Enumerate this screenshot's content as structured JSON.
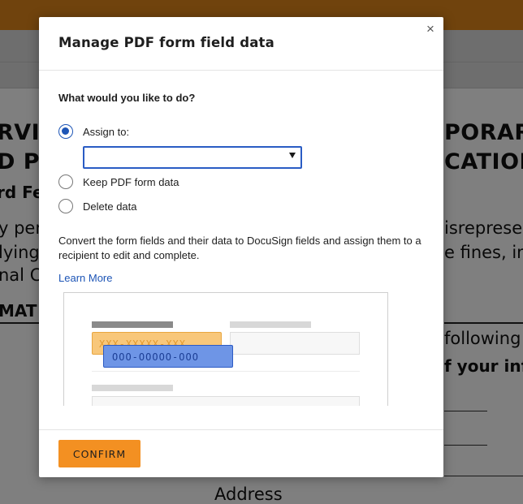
{
  "background": {
    "document_text": {
      "left_line1": "RVIC",
      "left_line2": "D PS",
      "left_line3": "rd Fe",
      "left_line4": "y per",
      "left_line5": "lying",
      "left_line6": "nal Co",
      "left_line7": "MAT",
      "right_line1": "PORAR",
      "right_line2": "CATION",
      "right_line3": "isrepresen",
      "right_line4": "e fines, im",
      "right_line5": "following i",
      "right_line6": "f your info",
      "bottom": "Address"
    }
  },
  "modal": {
    "title": "Manage PDF form field data",
    "close_glyph": "×",
    "question": "What would you like to do?",
    "options": [
      {
        "label": "Assign to:",
        "checked": true
      },
      {
        "label": "Keep PDF form data",
        "checked": false
      },
      {
        "label": "Delete data",
        "checked": false
      }
    ],
    "assign_select": {
      "value": ""
    },
    "description": "Convert the form fields and their data to DocuSign fields and assign them to a recipient to edit and complete.",
    "learn_more": "Learn More",
    "illustration": {
      "source_field_text": "XXX-XXXXX-XXX",
      "docusign_field_text": "OOO-OOOOO-OOO"
    },
    "confirm_label": "CONFIRM"
  },
  "colors": {
    "brand_orange": "#f39022",
    "header_orange": "#e0871a",
    "link_blue": "#1d55b6",
    "field_blue": "#6e95e6",
    "field_orange": "#f8c77a"
  }
}
